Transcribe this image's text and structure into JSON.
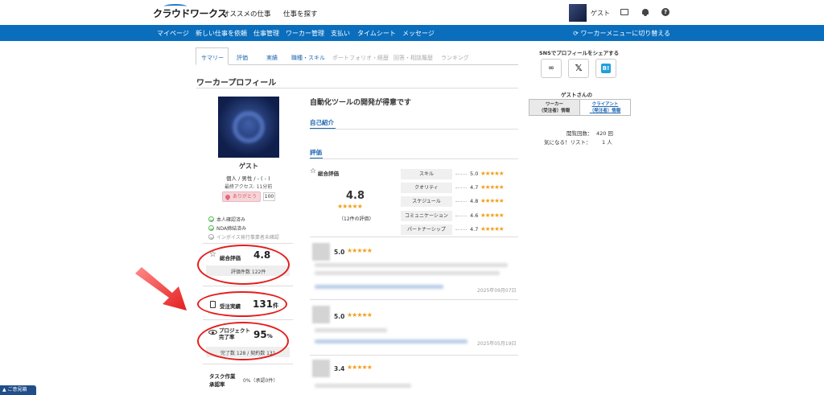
{
  "header": {
    "logo": "クラウドワークス",
    "nav": [
      "オススメの仕事",
      "仕事を探す"
    ],
    "guest": "ゲスト"
  },
  "bluebar": {
    "items": [
      "マイページ",
      "新しい仕事を依頼",
      "仕事管理",
      "ワーカー管理",
      "支払い",
      "タイムシート",
      "メッセージ"
    ],
    "switch": "ワーカーメニューに切り替える"
  },
  "tabs": [
    {
      "label": "サマリー",
      "active": true
    },
    {
      "label": "評価"
    },
    {
      "label": "実績"
    },
    {
      "label": "職種・スキル"
    },
    {
      "label": "ポートフォリオ・経歴",
      "dim": true
    },
    {
      "label": "回答・相談履歴",
      "dim": true
    },
    {
      "label": "ランキング",
      "dim": true
    }
  ],
  "section_title": "ワーカープロフィール",
  "profile": {
    "name": "ゲスト",
    "attributes": "個人 / 男性 / - ( - )",
    "last_access": "最終アクセス: 11分前",
    "thanks_label": "ありがとう",
    "thanks_count": "100",
    "verifications": [
      {
        "label": "本人確認済み",
        "ok": true
      },
      {
        "label": "NDA締結済み",
        "ok": true
      },
      {
        "label": "インボイス発行事業者未確認",
        "ok": false
      }
    ],
    "rating_label": "総合評価",
    "rating_value": "4.8",
    "rating_count": "評価件数 122件",
    "orders_label": "受注実績",
    "orders_value": "131",
    "orders_unit": "件",
    "completion_label_1": "プロジェクト",
    "completion_label_2": "完了率",
    "completion_value": "95",
    "completion_unit": "%",
    "completion_detail": "完了数 128 / 契約数 131",
    "task_label_1": "タスク作業",
    "task_label_2": "承認率",
    "task_value": "0%（承認0件）"
  },
  "center": {
    "headline": "自動化ツールの開発が得意です",
    "intro_tab": "自己紹介",
    "rating_tab": "評価",
    "overall_label": "総合評価",
    "overall_score": "4.8",
    "overall_count": "（12件の評価）",
    "skills": [
      {
        "label": "スキル",
        "score": "5.0"
      },
      {
        "label": "クオリティ",
        "score": "4.7"
      },
      {
        "label": "スケジュール",
        "score": "4.8"
      },
      {
        "label": "コミュニケーション",
        "score": "4.6"
      },
      {
        "label": "パートナーシップ",
        "score": "4.7"
      }
    ],
    "reviews": [
      {
        "score": "5.0",
        "stars": 5,
        "date": "2025年09月07日"
      },
      {
        "score": "5.0",
        "stars": 5,
        "date": "2025年05月19日"
      },
      {
        "score": "3.4",
        "stars": 3,
        "date": ""
      }
    ]
  },
  "sidebar": {
    "share_title": "SNSでプロフィールをシェアする",
    "guest_of": "ゲストさんの",
    "worker_tab_1": "ワーカー",
    "worker_tab_2": "（受注者）情報",
    "client_tab_1": "クライアント",
    "client_tab_2": "（発注者）情報",
    "views_label": "閲覧回数：",
    "views_value": "420 回",
    "fav_label": "気になる！リスト：",
    "fav_value": "1 人"
  },
  "feedback": "▲ ご意見箱",
  "colors": {
    "brand_blue": "#0a6ebd",
    "star": "#f0a020",
    "annotation_red": "#e41e1e"
  }
}
